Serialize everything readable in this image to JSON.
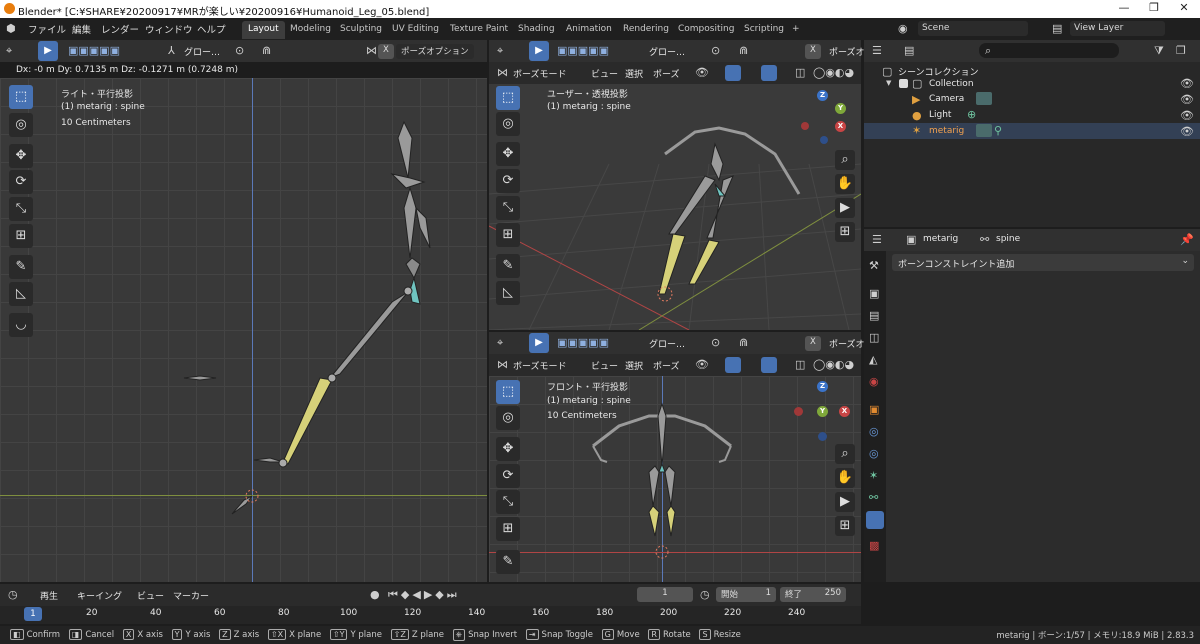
{
  "window": {
    "title": "Blender* [C:¥SHARE¥20200917¥MRが楽しい¥20200916¥Humanoid_Leg_05.blend]",
    "min": "—",
    "max": "❐",
    "close": "✕"
  },
  "menu": {
    "items": [
      "ファイル",
      "編集",
      "レンダー",
      "ウィンドウ",
      "ヘルプ"
    ]
  },
  "workspaces": [
    "Layout",
    "Modeling",
    "Sculpting",
    "UV Editing",
    "Texture Paint",
    "Shading",
    "Animation",
    "Rendering",
    "Compositing",
    "Scripting",
    "+"
  ],
  "scene": {
    "label": "Scene",
    "view_layer": "View Layer"
  },
  "left_vp": {
    "orient": "グロー…",
    "pose_options": "ポーズオプション",
    "transform": "Dx: -0 m   Dy: 0.7135 m   Dz: -0.1271 m (0.7248 m)",
    "view_name": "ライト・平行投影",
    "object": "(1) metarig : spine",
    "scale": "10 Centimeters"
  },
  "tr_vp": {
    "orient": "グロー…",
    "pose_options": "ポーズオ",
    "mode": "ボーズモード",
    "menu": [
      "ビュー",
      "選択",
      "ポーズ"
    ],
    "view_name": "ユーザー・透視投影",
    "object": "(1) metarig : spine"
  },
  "br_vp": {
    "orient": "グロー…",
    "pose_options": "ポーズオ",
    "mode": "ボーズモード",
    "menu": [
      "ビュー",
      "選択",
      "ポーズ"
    ],
    "view_name": "フロント・平行投影",
    "object": "(1) metarig : spine",
    "scale": "10 Centimeters"
  },
  "axes": {
    "x": "X",
    "y": "Y",
    "z": "Z"
  },
  "outliner": {
    "title": "シーンコレクション",
    "collection": "Collection",
    "items": [
      "Camera",
      "Light",
      "metarig"
    ]
  },
  "properties": {
    "object": "metarig",
    "bone": "spine",
    "add_constraint": "ボーンコンストレイント追加"
  },
  "timeline": {
    "menu": [
      "再生",
      "キーイング",
      "ビュー",
      "マーカー"
    ],
    "start_label": "開始",
    "start": "1",
    "end_label": "終了",
    "end": "250",
    "current": "1",
    "ticks": [
      "20",
      "40",
      "60",
      "80",
      "100",
      "120",
      "140",
      "160",
      "180",
      "200",
      "220",
      "240"
    ]
  },
  "status": {
    "items": [
      [
        "",
        "Confirm"
      ],
      [
        "",
        "Cancel"
      ],
      [
        "X",
        "X axis"
      ],
      [
        "Y",
        "Y axis"
      ],
      [
        "Z",
        "Z axis"
      ],
      [
        "⇧X",
        "X plane"
      ],
      [
        "⇧Y",
        "Y plane"
      ],
      [
        "⇧Z",
        "Z plane"
      ],
      [
        "",
        "Snap Invert"
      ],
      [
        "",
        "Snap Toggle"
      ],
      [
        "G",
        "Move"
      ],
      [
        "R",
        "Rotate"
      ],
      [
        "S",
        "Resize"
      ]
    ],
    "right": "metarig | ボーン:1/57 | メモリ:18.9 MiB | 2.83.3"
  },
  "colors": {
    "bone_yellow": "#d6d179",
    "bone_grey": "#9a9a9a",
    "bone_cyan": "#6fc4c0",
    "accent": "#4772b3"
  }
}
